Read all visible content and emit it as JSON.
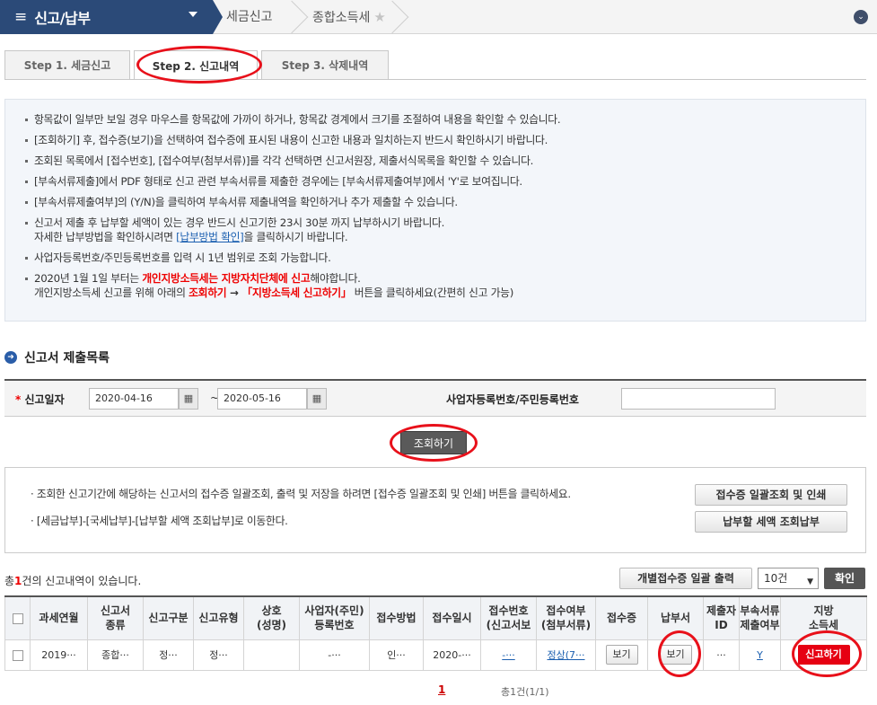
{
  "topbar": {
    "menu_title": "신고/납부",
    "crumbs": [
      "세금신고",
      "종합소득세"
    ]
  },
  "tabs": [
    {
      "label": "Step 1. 세금신고"
    },
    {
      "label": "Step 2. 신고내역"
    },
    {
      "label": "Step 3. 삭제내역"
    }
  ],
  "info": {
    "l1": "항목값이 일부만 보일 경우 마우스를 항목값에 가까이 하거나, 항목값 경계에서 크기를 조절하여 내용을 확인할 수 있습니다.",
    "l2": "[조회하기] 후, 접수증(보기)을 선택하여 접수증에 표시된 내용이 신고한 내용과 일치하는지 반드시 확인하시기 바랍니다.",
    "l3": "조회된 목록에서 [접수번호], [접수여부(첨부서류)]를 각각 선택하면 신고서원장, 제출서식목록을 확인할 수 있습니다.",
    "l4": "[부속서류제출]에서 PDF 형태로 신고 관련 부속서류를 제출한 경우에는 [부속서류제출여부]에서 'Y'로 보여집니다.",
    "l5": "[부속서류제출여부]의 (Y/N)을 클릭하여 부속서류 제출내역을 확인하거나 추가 제출할 수 있습니다.",
    "l6a": "신고서 제출 후 납부할 세액이 있는 경우 반드시 신고기한 23시 30분 까지 납부하시기 바랍니다.",
    "l6b_pre": "자세한 납부방법을 확인하시려면 ",
    "l6b_link": "[납부방법 확인]",
    "l6b_post": "을 클릭하시기 바랍니다.",
    "l7": "사업자등록번호/주민등록번호를 입력 시 1년 범위로 조회 가능합니다.",
    "l8a_pre": "2020년 1월 1일 부터는 ",
    "l8a_red": "개인지방소득세는 지방자치단체에 신고",
    "l8a_post": "해야합니다.",
    "l8b_pre": "개인지방소득세 신고를 위해 아래의 ",
    "l8b_red1": "조회하기",
    "l8b_arrow": " → ",
    "l8b_red2": "「지방소득세 신고하기」",
    "l8b_post": " 버튼을 클릭하세요(간편히 신고 가능)"
  },
  "section": {
    "title": "신고서 제출목록"
  },
  "search": {
    "req_mark": "*",
    "date_label": "신고일자",
    "date_from": "2020-04-16",
    "date_to": "2020-05-16",
    "tilde": "~",
    "id_label": "사업자등록번호/주민등록번호",
    "id_value": "",
    "search_button": "조회하기"
  },
  "notice": {
    "line1": "· 조회한 신고기간에 해당하는 신고서의 접수증 일괄조회, 출력 및 저장을 하려면 [접수증 일괄조회 및 인쇄] 버튼을 클릭하세요.",
    "line2": "· [세금납부]-[국세납부]-[납부할 세액 조회납부]로 이동한다.",
    "btn1": "접수증 일괄조회 및 인쇄",
    "btn2": "납부할 세액 조회납부"
  },
  "list": {
    "count_pre": "총",
    "count_num": "1",
    "count_post": "건의 신고내역이 있습니다.",
    "print_button": "개별접수증 일괄 출력",
    "page_size": "10건",
    "confirm_button": "확인",
    "headers": [
      "과세연월",
      "신고서\n종류",
      "신고구분",
      "신고유형",
      "상호\n(성명)",
      "사업자(주민)\n등록번호",
      "접수방법",
      "접수일시",
      "접수번호\n(신고서보",
      "접수여부\n(첨부서류)",
      "접수증",
      "납부서",
      "제출자\nID",
      "부속서류\n제출여부",
      "지방\n소득세"
    ],
    "row": {
      "c1": "2019···",
      "c2": "종합···",
      "c3": "정···",
      "c4": "정···",
      "c5": "",
      "c6": "-···",
      "c7": "인···",
      "c8": "2020-···",
      "c9": "-···",
      "c10": "정상(7···",
      "c11": "보기",
      "c12": "보기",
      "c13": "···",
      "c14": "Y",
      "c15": "신고하기"
    }
  },
  "pagination": {
    "current": "1",
    "info": "총1건(1/1)"
  }
}
